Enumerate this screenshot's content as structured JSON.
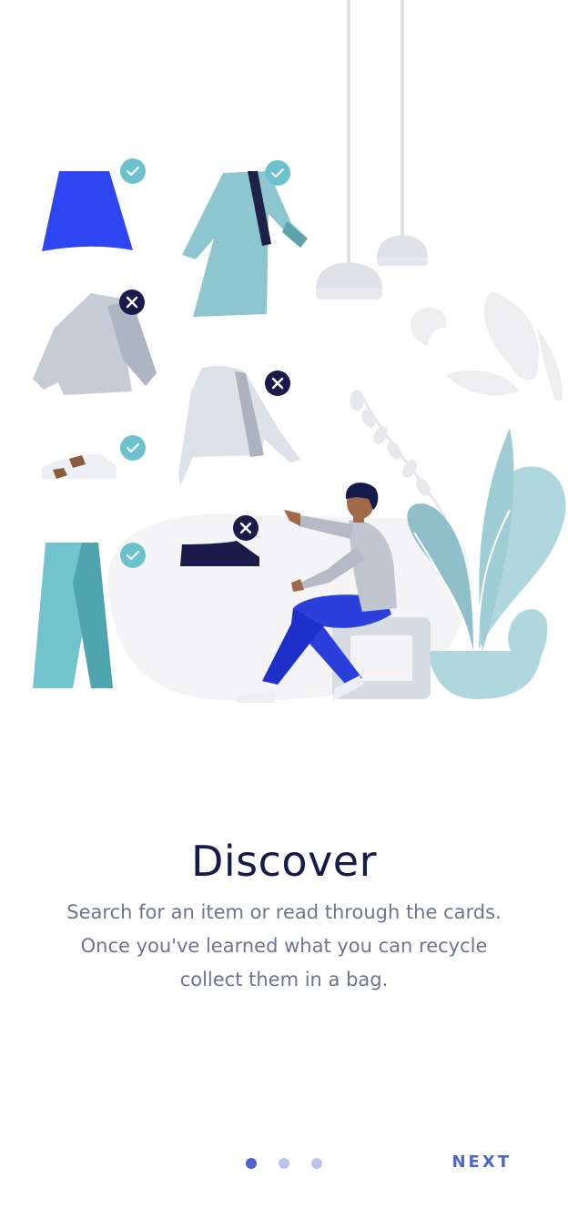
{
  "onboarding": {
    "title": "Discover",
    "description_lines": [
      "Search for an item or read through the cards.",
      "Once you've learned what you can recycle",
      "collect them in a bag."
    ],
    "current_page": 1,
    "total_pages": 3,
    "next_label": "NEXT"
  },
  "colors": {
    "title": "#141a4a",
    "body_text": "#6e7392",
    "accent": "#4c63d2",
    "dot_inactive": "#b9c3ef",
    "check_badge": "#6cc2cb",
    "cross_badge": "#1a1a4b",
    "skirt_blue": "#2e46f2"
  },
  "illustration": {
    "icons": [
      "check-badge-icon",
      "cross-badge-icon",
      "skirt-icon",
      "coat-icon",
      "sweater-icon",
      "hoodie-icon",
      "sneaker-icon",
      "shoe-icon",
      "pants-icon",
      "person-figure",
      "plant-icon",
      "pendant-lamp-icon"
    ]
  }
}
